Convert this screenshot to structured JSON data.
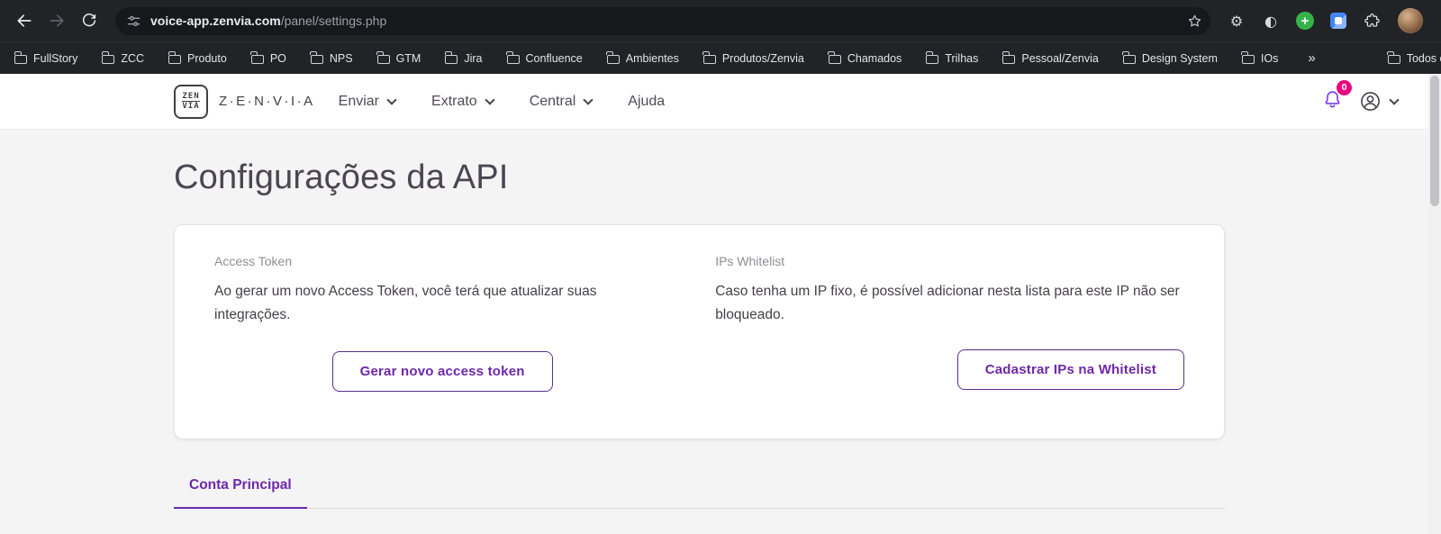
{
  "browser": {
    "url_host": "voice-app.zenvia.com",
    "url_path": "/panel/settings.php",
    "bookmarks": [
      "FullStory",
      "ZCC",
      "Produto",
      "PO",
      "NPS",
      "GTM",
      "Jira",
      "Confluence",
      "Ambientes",
      "Produtos/Zenvia",
      "Chamados",
      "Trilhas",
      "Pessoal/Zenvia",
      "Design System",
      "IOs"
    ],
    "overflow_chevron": "»",
    "all_favorites_label": "Todos os favoritos"
  },
  "icons": {
    "gear": "⚙",
    "theme_toggle": "◐",
    "plus": "+"
  },
  "app": {
    "brand": "Z·E·N·V·I·A",
    "logo_top": "ZEN",
    "logo_bottom": "VIA",
    "nav": [
      "Enviar",
      "Extrato",
      "Central",
      "Ajuda"
    ],
    "notification_count": "0"
  },
  "page": {
    "title": "Configurações da API",
    "sections": [
      {
        "label": "Access Token",
        "description": "Ao gerar um novo Access Token, você terá que atualizar suas integrações.",
        "button_label": "Gerar novo access token"
      },
      {
        "label": "IPs Whitelist",
        "description": "Caso tenha um IP fixo, é possível adicionar nesta lista para este IP não ser bloqueado.",
        "button_label": "Cadastrar IPs na Whitelist"
      }
    ],
    "active_tab": "Conta Principal"
  },
  "colors": {
    "accent": "#6d28a9",
    "badge": "#e5097f"
  }
}
